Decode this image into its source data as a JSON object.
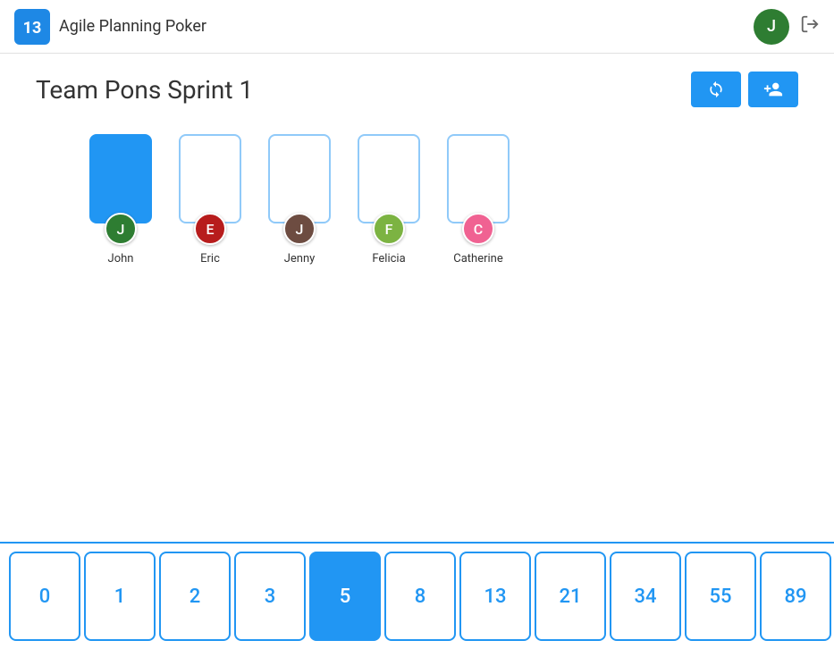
{
  "header": {
    "logo_text": "Agile Planning Poker",
    "avatar_letter": "J"
  },
  "session": {
    "title": "Team Pons Sprint 1",
    "reset_label": "reset",
    "invite_label": "invite"
  },
  "players": [
    {
      "id": "john",
      "name": "John",
      "letter": "J",
      "avatar_color": "#2e7d32",
      "selected": true
    },
    {
      "id": "eric",
      "name": "Eric",
      "letter": "E",
      "avatar_color": "#b71c1c",
      "selected": false
    },
    {
      "id": "jenny",
      "name": "Jenny",
      "letter": "J",
      "avatar_color": "#6d4c41",
      "selected": false
    },
    {
      "id": "felicia",
      "name": "Felicia",
      "letter": "F",
      "avatar_color": "#7cb342",
      "selected": false
    },
    {
      "id": "catherine",
      "name": "Catherine",
      "letter": "C",
      "avatar_color": "#f06292",
      "selected": false
    }
  ],
  "voting_cards": [
    {
      "value": "0",
      "active": false
    },
    {
      "value": "1",
      "active": false
    },
    {
      "value": "2",
      "active": false
    },
    {
      "value": "3",
      "active": false
    },
    {
      "value": "5",
      "active": true
    },
    {
      "value": "8",
      "active": false
    },
    {
      "value": "13",
      "active": false
    },
    {
      "value": "21",
      "active": false
    },
    {
      "value": "34",
      "active": false
    },
    {
      "value": "55",
      "active": false
    },
    {
      "value": "89",
      "active": false
    }
  ]
}
